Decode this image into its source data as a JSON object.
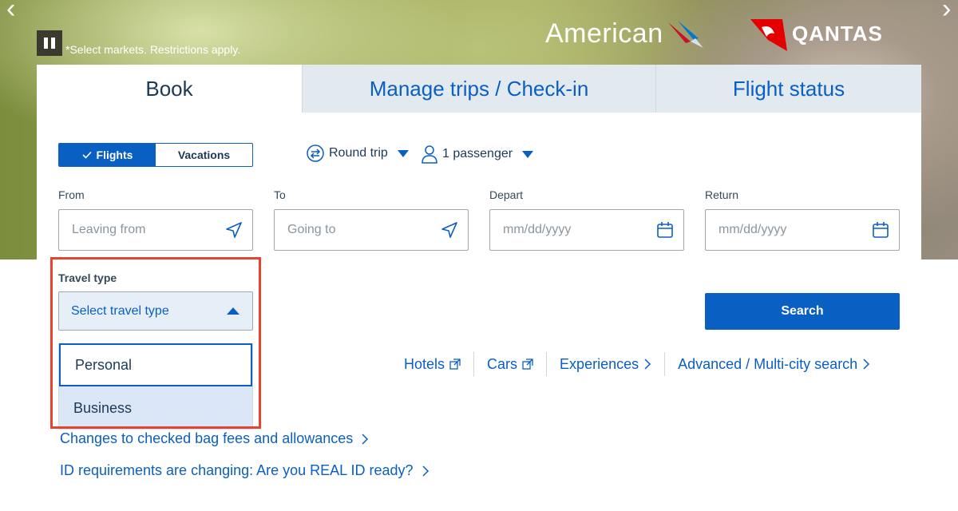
{
  "hero": {
    "disclaimer": "*Select markets. Restrictions apply.",
    "prev_label": "‹",
    "next_label": "›",
    "brands": {
      "american": "American",
      "qantas": "QANTAS"
    },
    "colors": {
      "american_red": "#c8102e",
      "american_blue": "#0078d2",
      "qantas_red": "#e40000"
    }
  },
  "tabs": [
    {
      "label": "Book",
      "active": true
    },
    {
      "label": "Manage trips / Check-in",
      "active": false
    },
    {
      "label": "Flight status",
      "active": false
    }
  ],
  "product_toggle": {
    "flights": "Flights",
    "vacations": "Vacations",
    "selected": "Flights"
  },
  "trip_type": {
    "label": "Round trip",
    "icon": "round-trip-icon"
  },
  "passengers": {
    "label": "1 passenger",
    "icon": "person-icon"
  },
  "form": {
    "from": {
      "label": "From",
      "placeholder": "Leaving from",
      "icon": "location-arrow-icon"
    },
    "to": {
      "label": "To",
      "placeholder": "Going to",
      "icon": "location-arrow-icon"
    },
    "depart": {
      "label": "Depart",
      "placeholder": "mm/dd/yyyy",
      "icon": "calendar-icon"
    },
    "return": {
      "label": "Return",
      "placeholder": "mm/dd/yyyy",
      "icon": "calendar-icon"
    }
  },
  "travel_type": {
    "label": "Travel type",
    "placeholder": "Select travel type",
    "expanded": true,
    "options": [
      "Personal",
      "Business"
    ],
    "focused": "Personal",
    "highlighted": "Business"
  },
  "search_button": "Search",
  "quick_links": [
    {
      "label": "Hotels",
      "icon": "external-link-icon"
    },
    {
      "label": "Cars",
      "icon": "external-link-icon"
    },
    {
      "label": "Experiences",
      "icon": "chevron-right-icon"
    },
    {
      "label": "Advanced / Multi-city search",
      "icon": "chevron-right-icon"
    }
  ],
  "news": [
    "Changes to checked bag fees and allowances",
    "ID requirements are changing: Are you REAL ID ready?"
  ],
  "colors": {
    "primary": "#0a5fc2",
    "tab_inactive_bg": "#e3eaef",
    "annotation_red": "#e8432f",
    "text_dark": "#1c3a57"
  }
}
